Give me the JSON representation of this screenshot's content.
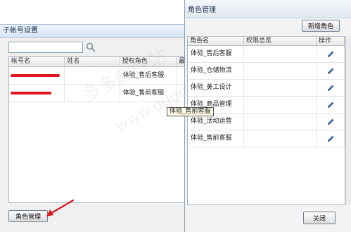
{
  "sub_window": {
    "title": "子帐号设置",
    "search": {
      "value": "",
      "placeholder": ""
    },
    "grid": {
      "headers": [
        "帐号名",
        "姓名",
        "授权角色",
        "最"
      ],
      "rows": [
        {
          "account": "",
          "name": "",
          "role": "体验_售后客服"
        },
        {
          "account": "",
          "name": "",
          "role": "体验_售前客服"
        }
      ]
    },
    "role_button_label": "角色管理"
  },
  "tooltip": "体验_售前客服",
  "dialog": {
    "title": "角色管理",
    "add_button_label": "新增角色",
    "headers": [
      "角色名",
      "权限总览",
      "操作"
    ],
    "rows": [
      {
        "role": "体验_售后客服"
      },
      {
        "role": "体验_仓储物流"
      },
      {
        "role": "体验_美工设计"
      },
      {
        "role": "体验_商品管理"
      },
      {
        "role": "体验_活动运营"
      },
      {
        "role": "体验_售前客服"
      }
    ],
    "close_button_label": "关闭"
  },
  "watermark": {
    "line1": "多多软件站",
    "line2": "www.ddooo.com"
  },
  "colors": {
    "redaction": "#e0151f",
    "arrow": "#e0151f",
    "edit_icon": "#3f6fa8"
  }
}
